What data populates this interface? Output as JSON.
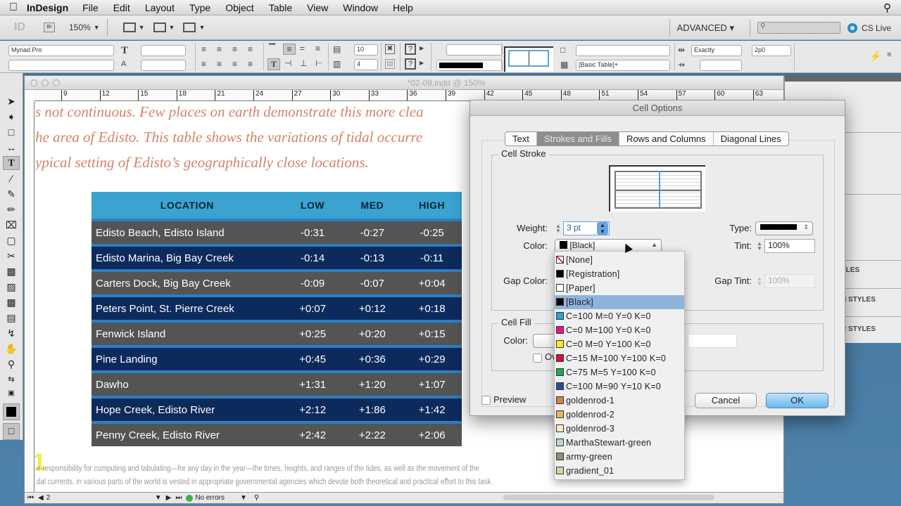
{
  "menubar": {
    "apple": "",
    "app_name": "InDesign",
    "items": [
      "File",
      "Edit",
      "Layout",
      "Type",
      "Object",
      "Table",
      "View",
      "Window",
      "Help"
    ],
    "search_icon": "magnifier"
  },
  "appbar": {
    "logo": "ID",
    "bridge": "Br",
    "zoom": "150%",
    "workspace": "ADVANCED",
    "search_placeholder": "",
    "cslive": "CS Live"
  },
  "control": {
    "font_family": "Myriad Pro",
    "font_style": "",
    "font_size": "",
    "leading": "",
    "rows": "10",
    "columns": "4",
    "cell_style": "",
    "table_style": "[Basic Table]+",
    "row_height_mode": "Exactly",
    "row_height": "2p0",
    "column_width": ""
  },
  "document": {
    "title": "*02-09.indd @ 150%",
    "ruler_ticks": [
      "9",
      "12",
      "15",
      "18",
      "21",
      "24",
      "27",
      "30",
      "33",
      "36",
      "39",
      "42",
      "45",
      "48",
      "51",
      "54",
      "57",
      "60",
      "63"
    ],
    "intro_lines": [
      "s not continuous. Few places on earth demonstrate this more clea",
      "he area of Edisto. This table shows the variations of tidal occurre",
      "ypical setting of Edisto’s geographically close locations."
    ],
    "footer_lines": [
      "e responsibility for computing and tabulating—for any day in the year—the times, heights, and ranges of the tides, as well as the movement of the",
      "dal currents, in various parts of the world is vested in appropriate governmental agencies which devote both theoretical and practical effort to this task."
    ],
    "page_number_marker": "1",
    "status": {
      "page": "2",
      "errors": "No errors"
    }
  },
  "tide_table": {
    "headers": [
      "LOCATION",
      "LOW",
      "MED",
      "HIGH"
    ],
    "rows": [
      [
        "Edisto Beach, Edisto Island",
        "-0:31",
        "-0:27",
        "-0:25"
      ],
      [
        "Edisto Marina, Big Bay Creek",
        "-0:14",
        "-0:13",
        "-0:11"
      ],
      [
        "Carters Dock, Big Bay Creek",
        "-0:09",
        "-0:07",
        "+0:04"
      ],
      [
        "Peters Point, St. Pierre Creek",
        "+0:07",
        "+0:12",
        "+0:18"
      ],
      [
        "Fenwick Island",
        "+0:25",
        "+0:20",
        "+0:15"
      ],
      [
        "Pine Landing",
        "+0:45",
        "+0:36",
        "+0:29"
      ],
      [
        "Dawho",
        "+1:31",
        "+1:20",
        "+1:07"
      ],
      [
        "Hope Creek, Edisto River",
        "+2:12",
        "+1:86",
        "+1:42"
      ],
      [
        "Penny Creek, Edisto River",
        "+2:42",
        "+2:22",
        "+2:06"
      ]
    ],
    "colors": {
      "header": "#3aa3cf",
      "row_gray": "#545454",
      "row_navy": "#0d2a5c",
      "divider": "#2d7fc4"
    }
  },
  "right_panel": {
    "sections": [
      "YLES",
      "H STYLES",
      "R STYLES"
    ]
  },
  "dialog": {
    "title": "Cell Options",
    "tabs": [
      "Text",
      "Strokes and Fills",
      "Rows and Columns",
      "Diagonal Lines"
    ],
    "active_tab": "Strokes and Fills",
    "cell_stroke": {
      "label": "Cell Stroke",
      "weight_label": "Weight:",
      "weight": "3 pt",
      "type_label": "Type:",
      "color_label": "Color:",
      "color": "[Black]",
      "tint_label": "Tint:",
      "tint": "100%",
      "gap_color_label": "Gap Color:",
      "gap_tint_label": "Gap Tint:",
      "gap_tint": "100%"
    },
    "cell_fill": {
      "label": "Cell Fill",
      "color_label": "Color:",
      "overprint_label": "Ov"
    },
    "preview_label": "Preview",
    "cancel": "Cancel",
    "ok": "OK"
  },
  "color_dropdown": {
    "selected": "[Black]",
    "options": [
      {
        "label": "[None]",
        "swatch": "none"
      },
      {
        "label": "[Registration]",
        "swatch": "#000000"
      },
      {
        "label": "[Paper]",
        "swatch": "#ffffff"
      },
      {
        "label": "[Black]",
        "swatch": "#000000"
      },
      {
        "label": "C=100 M=0 Y=0 K=0",
        "swatch": "#1fa8dc"
      },
      {
        "label": "C=0 M=100 Y=0 K=0",
        "swatch": "#e6158a"
      },
      {
        "label": "C=0 M=0 Y=100 K=0",
        "swatch": "#f5ee2a"
      },
      {
        "label": "C=15 M=100 Y=100 K=0",
        "swatch": "#d4123a"
      },
      {
        "label": "C=75 M=5 Y=100 K=0",
        "swatch": "#1faa55"
      },
      {
        "label": "C=100 M=90 Y=10 K=0",
        "swatch": "#24529a"
      },
      {
        "label": "goldenrod-1",
        "swatch": "#d8804a"
      },
      {
        "label": "goldenrod-2",
        "swatch": "#f0b066"
      },
      {
        "label": "goldenrod-3",
        "swatch": "#f4efc0"
      },
      {
        "label": "MarthaStewart-green",
        "swatch": "#b8d8c8"
      },
      {
        "label": "army-green",
        "swatch": "#8e8e72"
      },
      {
        "label": "gradient_01",
        "swatch": "#d8d2a8"
      }
    ]
  }
}
